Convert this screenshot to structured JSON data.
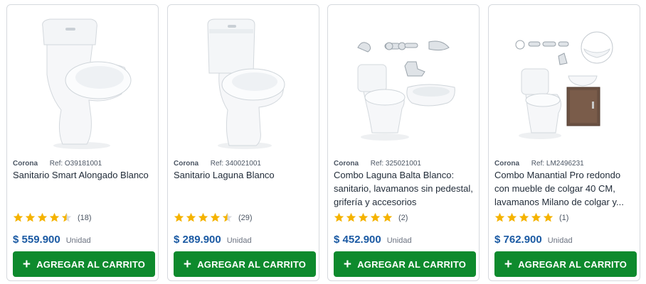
{
  "colors": {
    "accent_green": "#0e8a2d",
    "price_blue": "#1b5aa3",
    "star_yellow": "#f5b301"
  },
  "products": [
    {
      "brand": "Corona",
      "ref": "Ref: O39181001",
      "title": "Sanitario Smart Alongado Blanco",
      "rating": 4.5,
      "reviews": "(18)",
      "price": "$ 559.900",
      "unit": "Unidad",
      "button_label": "AGREGAR AL CARRITO"
    },
    {
      "brand": "Corona",
      "ref": "Ref: 340021001",
      "title": "Sanitario Laguna Blanco",
      "rating": 4.5,
      "reviews": "(29)",
      "price": "$ 289.900",
      "unit": "Unidad",
      "button_label": "AGREGAR AL CARRITO"
    },
    {
      "brand": "Corona",
      "ref": "Ref: 325021001",
      "title": "Combo Laguna Balta Blanco: sanitario, lavamanos sin pedestal, grifería y accesorios",
      "rating": 5,
      "reviews": "(2)",
      "price": "$ 452.900",
      "unit": "Unidad",
      "button_label": "AGREGAR AL CARRITO"
    },
    {
      "brand": "Corona",
      "ref": "Ref: LM2496231",
      "title": "Combo Manantial Pro redondo con mueble de colgar 40 CM, lavamanos Milano de colgar y...",
      "rating": 5,
      "reviews": "(1)",
      "price": "$ 762.900",
      "unit": "Unidad",
      "button_label": "AGREGAR AL CARRITO"
    }
  ]
}
